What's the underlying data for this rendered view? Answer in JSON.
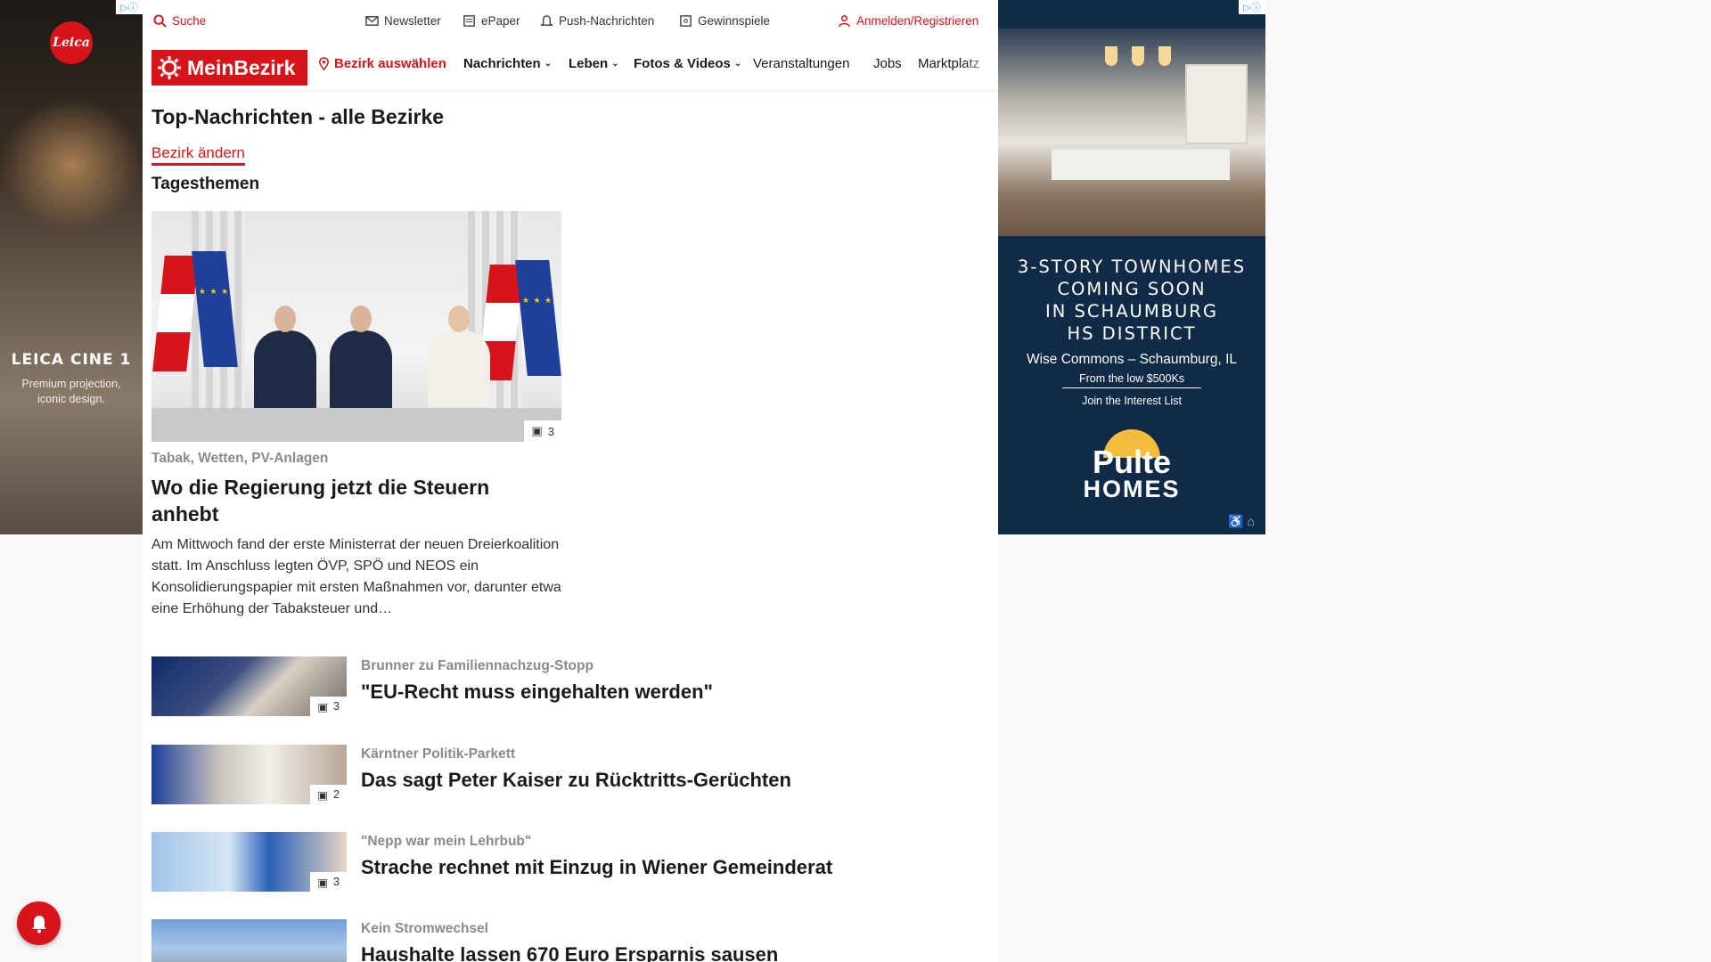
{
  "left_ad": {
    "brand_logo": "Leica",
    "title": "LEICA CINE 1",
    "subtitle": "Premium projection, iconic design."
  },
  "topbar": {
    "search": "Suche",
    "newsletter": "Newsletter",
    "epaper": "ePaper",
    "push": "Push-Nachrichten",
    "contests": "Gewinnspiele",
    "login": "Anmelden/Registrieren"
  },
  "nav": {
    "logo": "MeinBezirk",
    "district": "Bezirk auswählen",
    "items": [
      "Nachrichten",
      "Leben",
      "Fotos & Videos",
      "Veranstaltungen",
      "Jobs",
      "Marktplatz"
    ]
  },
  "page": {
    "title": "Top-Nachrichten - alle Bezirke",
    "change_district": "Bezirk ändern",
    "section": "Tagesthemen"
  },
  "lead_article": {
    "kicker": "Tabak, Wetten, PV-Anlagen",
    "headline": "Wo die Regierung jetzt die Steuern anhebt",
    "teaser": "Am Mittwoch fand der erste Ministerrat der neuen Dreierkoalition statt. Im Anschluss legten ÖVP, SPÖ und NEOS ein Konsolidierungspapier mit ersten Maßnahmen vor, darunter etwa eine Erhöhung der Tabaksteuer und…",
    "gallery_count": "3"
  },
  "articles": [
    {
      "kicker": "Brunner zu Familiennachzug-Stopp",
      "headline": "\"EU-Recht muss eingehalten werden\"",
      "gallery_count": "3"
    },
    {
      "kicker": "Kärntner Politik-Parkett",
      "headline": "Das sagt Peter Kaiser zu Rücktritts-Gerüchten",
      "gallery_count": "2"
    },
    {
      "kicker": "\"Nepp war mein Lehrbub\"",
      "headline": "Strache rechnet mit Einzug in Wiener Gemeinderat",
      "gallery_count": "3"
    },
    {
      "kicker": "Kein Stromwechsel",
      "headline": "Haushalte lassen 670 Euro Ersparnis sausen",
      "gallery_count": ""
    }
  ],
  "right_ad": {
    "headline_lines": [
      "3-STORY TOWNHOMES",
      "COMING SOON",
      "IN SCHAUMBURG",
      "HS DISTRICT"
    ],
    "place": "Wise Commons – Schaumburg, IL",
    "price": "From the low $500Ks",
    "cta": "Join the Interest List",
    "brand_line1": "Pulte",
    "brand_line2": "HOMES"
  },
  "colors": {
    "brand_red": "#d7141a",
    "ad_navy": "#0f2b48",
    "kicker_gray": "#8a8a8a"
  }
}
